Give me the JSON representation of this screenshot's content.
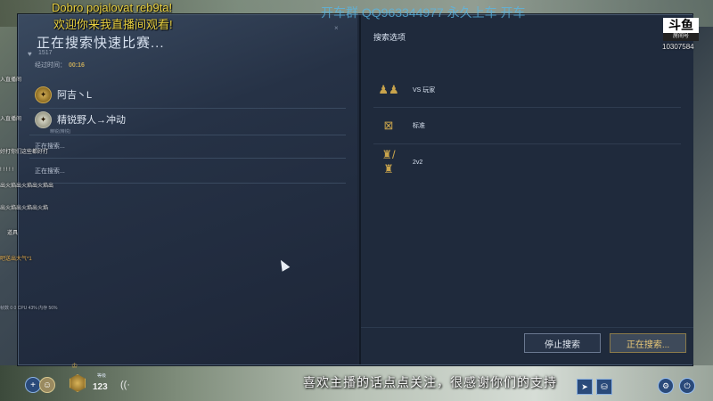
{
  "overlay": {
    "greeting": "Dobro pojalovat reb9ta!",
    "welcome": "欢迎你来我直播间观看!",
    "qq_watermark": "开车群  QQ963344977  永久上车 开车",
    "logo_main": "斗鱼",
    "logo_sub": "房间号",
    "room_id": "10307584",
    "subtitle": "喜欢主播的话点点关注，很感谢你们的支持"
  },
  "left": {
    "title": "正在搜索快速比赛...",
    "close_glyph": "×",
    "likes": "1517",
    "elapsed_label": "经过时间：",
    "elapsed_value": "00:16",
    "players": [
      {
        "name": "阿吉丶L",
        "sub": ""
      },
      {
        "name": "精锐野人→冲动",
        "sub": "精锐(精锐)"
      }
    ],
    "searching_1": "正在搜索...",
    "searching_2": "正在搜索..."
  },
  "chat": [
    {
      "text": "入直播间",
      "color": "white"
    },
    {
      "text": "入直播间",
      "color": "white"
    },
    {
      "text": "好打你们这些都好打",
      "color": "white"
    },
    {
      "text": "! ! ! ! !",
      "color": "white"
    },
    {
      "text": "出火焰出火焰出火焰出",
      "color": "white"
    },
    {
      "text": "出火焰出火焰出火焰",
      "color": "white"
    },
    {
      "text": "道具",
      "color": "white"
    },
    {
      "text": "吧送出大气*1",
      "color": "orange"
    },
    {
      "text": "帧数 0 0  CPU 43%  内存 56%",
      "color": "white"
    }
  ],
  "right": {
    "title": "搜索选项",
    "options": [
      {
        "icon": "vs-players-icon",
        "glyph": "♟♟",
        "label": "VS 玩家"
      },
      {
        "icon": "standard-icon",
        "glyph": "⊠",
        "label": "标准"
      },
      {
        "icon": "two-v-two-icon",
        "glyph": "♜/♜",
        "label": "2v2"
      }
    ],
    "stop_button": "停止搜索",
    "searching_button": "正在搜索..."
  },
  "bottom": {
    "add_glyph": "+",
    "crown_glyph": "♔",
    "level_label": "等级",
    "level_value": "123",
    "wifi_glyph": "((·",
    "arrow_glyph": "➤",
    "chest_glyph": "⛁",
    "settings_glyph": "⚙",
    "power_glyph": "⏻"
  },
  "colors": {
    "accent_gold": "#c9a44c",
    "panel_bg": "#1f2a3c",
    "overlay_yellow": "#e8d040"
  }
}
